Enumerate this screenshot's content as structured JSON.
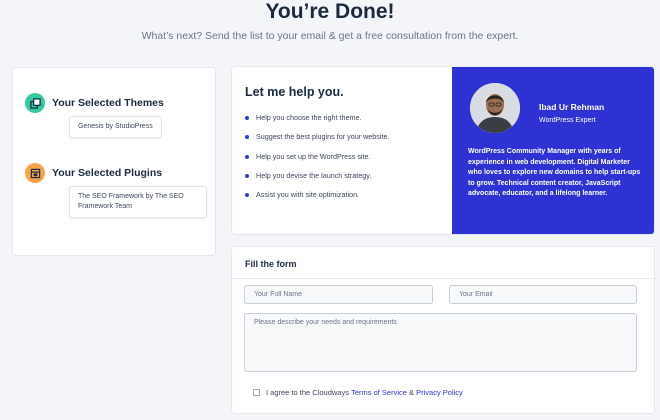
{
  "header": {
    "title": "You’re Done!",
    "subtitle": "What’s next? Send the list to your email & get a free consultation from the expert."
  },
  "selections": {
    "themes_title": "Your Selected Themes",
    "themes": [
      "Genesis by StudioPress"
    ],
    "plugins_title": "Your Selected Plugins",
    "plugins": [
      "The SEO Framework by The SEO Framework Team"
    ]
  },
  "help": {
    "title": "Let me help you.",
    "items": [
      "Help you choose the right theme.",
      "Suggest the best plugins for your website.",
      "Help you set up the WordPress site.",
      "Help you devise the launch strategy.",
      "Assist you with site optimization."
    ]
  },
  "expert": {
    "name": "Ibad Ur Rehman",
    "role": "WordPress Expert",
    "bio": "WordPress Community Manager with years of experience in web development. Digital Marketer who loves to explore new domains to help start-ups to grow. Technical content creator, JavaScript advocate, educator, and a lifelong learner."
  },
  "form": {
    "title": "Fill the form",
    "name_placeholder": "Your Full Name",
    "email_placeholder": "Your Email",
    "message_placeholder": "Please describe your needs and requirements",
    "consent_prefix": "I agree to the Cloudways",
    "terms_label": "Terms of Service",
    "amp": "&",
    "privacy_label": "Privacy Policy"
  },
  "colors": {
    "accent": "#2f32d2",
    "themes_icon": "#36c9a0",
    "plugins_icon": "#f6a54a"
  }
}
